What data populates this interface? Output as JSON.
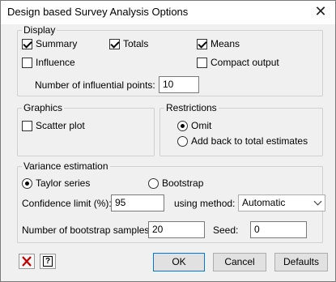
{
  "window": {
    "title": "Design based Survey Analysis Options",
    "close_glyph": "✕"
  },
  "display": {
    "label": "Display",
    "summary": {
      "label": "Summary",
      "checked": true
    },
    "totals": {
      "label": "Totals",
      "checked": true
    },
    "means": {
      "label": "Means",
      "checked": true
    },
    "influence": {
      "label": "Influence",
      "checked": false
    },
    "compact_output": {
      "label": "Compact output",
      "checked": false
    },
    "influential_points": {
      "label": "Number of influential points:",
      "value": "10"
    }
  },
  "graphics": {
    "label": "Graphics",
    "scatter_plot": {
      "label": "Scatter plot",
      "checked": false
    }
  },
  "restrictions": {
    "label": "Restrictions",
    "omit": {
      "label": "Omit",
      "selected": true
    },
    "add_back": {
      "label": "Add back to total estimates",
      "selected": false
    }
  },
  "variance": {
    "label": "Variance estimation",
    "taylor": {
      "label": "Taylor series",
      "selected": true
    },
    "bootstrap": {
      "label": "Bootstrap",
      "selected": false
    },
    "confidence": {
      "label": "Confidence limit (%):",
      "value": "95"
    },
    "method": {
      "label": "using method:",
      "value": "Automatic"
    },
    "bootstrap_samples": {
      "label": "Number of bootstrap samples:",
      "value": "20"
    },
    "seed": {
      "label": "Seed:",
      "value": "0"
    }
  },
  "footer": {
    "clear_icon": "red-x-icon",
    "help_icon": "help-question-icon",
    "help_glyph": "?",
    "ok": "OK",
    "cancel": "Cancel",
    "defaults": "Defaults"
  },
  "colors": {
    "accent": "#0078d7",
    "clear_red": "#c00000"
  }
}
